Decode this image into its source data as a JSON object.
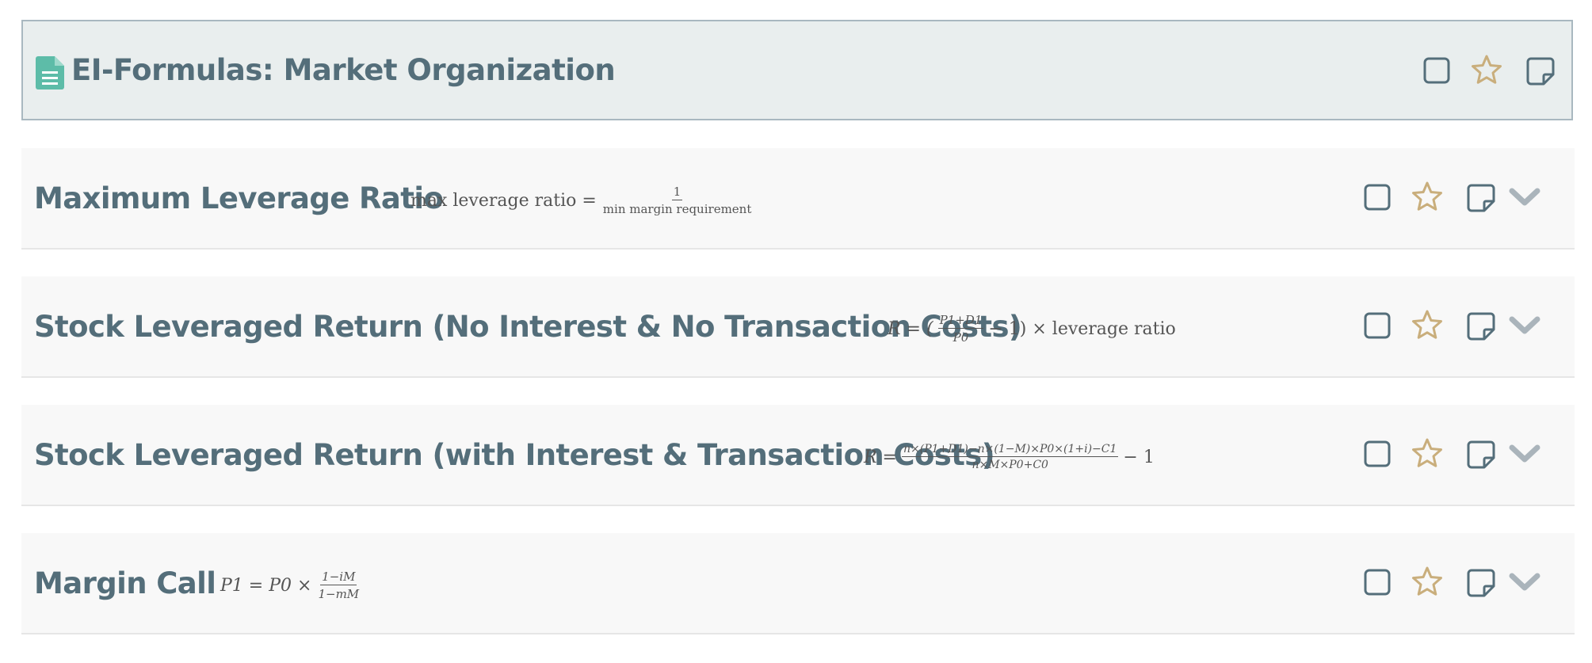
{
  "header": {
    "title": "EI-Formulas: Market Organization",
    "icons": [
      "document-icon",
      "checkbox-icon",
      "star-icon",
      "note-icon"
    ]
  },
  "colors": {
    "title_text": "#546e7a",
    "header_bg": "#e9eeee",
    "row_bg": "#f8f8f8",
    "star": "#c9ae7c",
    "document_icon": "#5dbca8",
    "chevron": "#aab4bb",
    "formula_text": "#555555"
  },
  "formulas": [
    {
      "title": "Maximum Leverage Ratio",
      "formula": {
        "lhs": "max leverage ratio =",
        "num": "1",
        "den": "min margin requirement"
      }
    },
    {
      "title": "Stock Leveraged Return (No Interest & No Transaction Costs)",
      "formula": {
        "lhs": "R = (",
        "num": "P1+D1",
        "den": "P0",
        "rhs": "− 1) × leverage ratio"
      }
    },
    {
      "title": "Stock Leveraged Return (with Interest & Transaction Costs)",
      "formula": {
        "lhs": "R =",
        "num": "n×(P1+D1)−n×(1−M)×P0×(1+i)−C1",
        "den": "n×M×P0+C0",
        "rhs": "− 1"
      }
    },
    {
      "title": "Margin Call",
      "formula": {
        "lhs": "P1 = P0 ×",
        "num": "1−iM",
        "den": "1−mM"
      }
    }
  ],
  "row_icons": [
    "checkbox-icon",
    "star-icon",
    "note-icon",
    "chevron-down-icon"
  ]
}
